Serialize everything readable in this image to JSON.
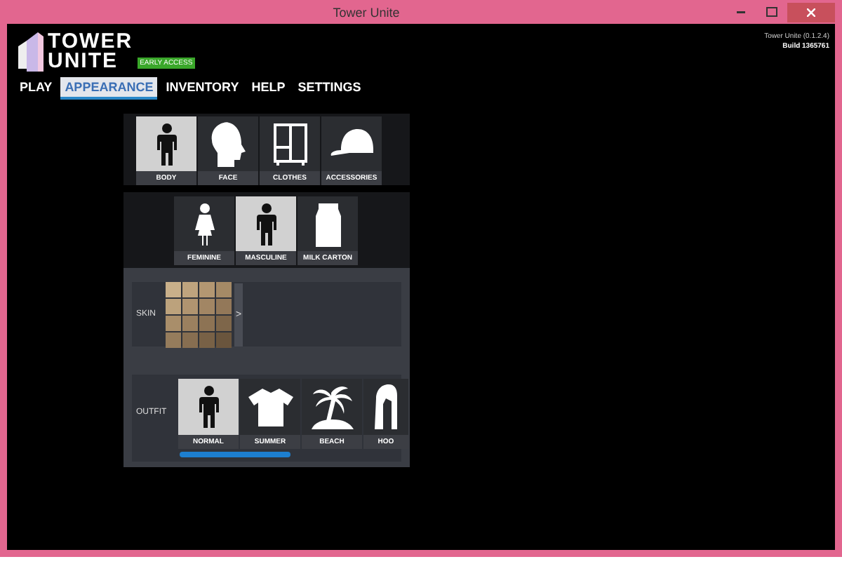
{
  "window": {
    "title": "Tower Unite"
  },
  "logo": {
    "line_1": "TOWER",
    "line_2": "UNITE",
    "badge": "EARLY ACCESS"
  },
  "version": {
    "name": "Tower Unite (0.1.2.4)",
    "build": "Build 1365761"
  },
  "nav": [
    {
      "label": "PLAY",
      "selected": false
    },
    {
      "label": "APPEARANCE",
      "selected": true
    },
    {
      "label": "INVENTORY",
      "selected": false
    },
    {
      "label": "HELP",
      "selected": false
    },
    {
      "label": "SETTINGS",
      "selected": false
    }
  ],
  "categories": [
    {
      "label": "BODY",
      "kind": "body",
      "selected": true
    },
    {
      "label": "FACE",
      "kind": "face",
      "selected": false
    },
    {
      "label": "CLOTHES",
      "kind": "clothes",
      "selected": false
    },
    {
      "label": "ACCESSORIES",
      "kind": "cap",
      "selected": false
    }
  ],
  "body_types": [
    {
      "label": "FEMININE",
      "kind": "female",
      "selected": false
    },
    {
      "label": "MASCULINE",
      "kind": "male",
      "selected": true
    },
    {
      "label": "MILK CARTON",
      "kind": "carton",
      "selected": false
    }
  ],
  "skin": {
    "label": "SKIN",
    "arrow": ">"
  },
  "outfit": {
    "label": "OUTFIT",
    "items": [
      {
        "label": "NORMAL",
        "kind": "male",
        "selected": true
      },
      {
        "label": "SUMMER",
        "kind": "shirt",
        "selected": false
      },
      {
        "label": "BEACH",
        "kind": "palm",
        "selected": false
      },
      {
        "label": "HOO",
        "kind": "hoodie",
        "selected": false
      }
    ]
  }
}
